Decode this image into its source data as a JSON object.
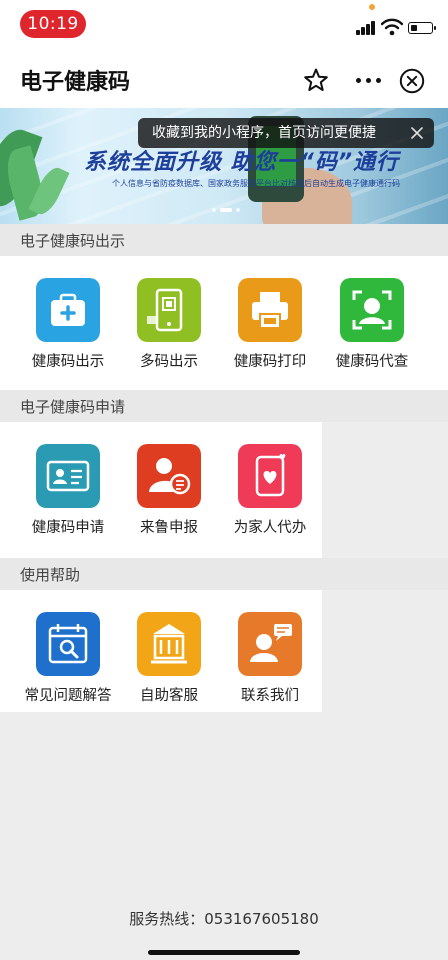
{
  "status_bar": {
    "time": "10:19"
  },
  "nav": {
    "title": "电子健康码"
  },
  "banner": {
    "title": "系统全面升级 助您一“码”通行",
    "subtitle": "个人信息与省防疫数据库、国家政务服务平台比对核验后自动生成电子健康通行码"
  },
  "tooltip": {
    "text": "收藏到我的小程序，首页访问更便捷"
  },
  "sections": [
    {
      "title": "电子健康码出示",
      "items": [
        {
          "label": "健康码出示",
          "icon": "medkit-icon",
          "color": "#2aa3e3"
        },
        {
          "label": "多码出示",
          "icon": "phone-qr-icon",
          "color": "#8fbf22"
        },
        {
          "label": "健康码打印",
          "icon": "printer-icon",
          "color": "#e89a18"
        },
        {
          "label": "健康码代查",
          "icon": "face-scan-icon",
          "color": "#2fb83c"
        }
      ]
    },
    {
      "title": "电子健康码申请",
      "items": [
        {
          "label": "健康码申请",
          "icon": "id-card-icon",
          "color": "#2b9bb3"
        },
        {
          "label": "来鲁申报",
          "icon": "person-doc-icon",
          "color": "#de3d22"
        },
        {
          "label": "为家人代办",
          "icon": "phone-heart-icon",
          "color": "#ef3b57"
        }
      ]
    },
    {
      "title": "使用帮助",
      "items": [
        {
          "label": "常见问题解答",
          "icon": "calendar-search-icon",
          "color": "#1f70cc"
        },
        {
          "label": "自助客服",
          "icon": "building-icon",
          "color": "#f2a617"
        },
        {
          "label": "联系我们",
          "icon": "contact-chat-icon",
          "color": "#e6792a"
        }
      ]
    }
  ],
  "footer": {
    "hotline": "服务热线：053167605180"
  }
}
